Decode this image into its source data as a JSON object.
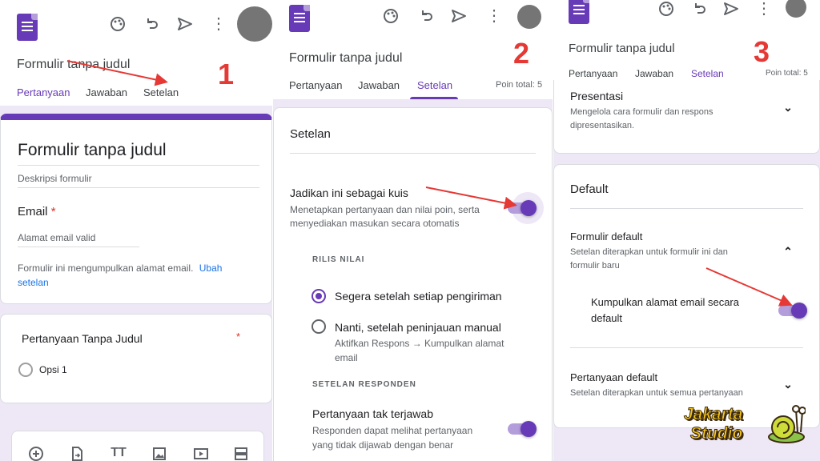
{
  "colors": {
    "accent": "#673ab7",
    "annotation": "#e53935",
    "background": "#ede7f6"
  },
  "panel1": {
    "form_title": "Formulir tanpa judul",
    "tabs": [
      "Pertanyaan",
      "Jawaban",
      "Setelan"
    ],
    "step": "1",
    "card_title": "Formulir tanpa judul",
    "description_placeholder": "Deskripsi formulir",
    "email_label": "Email",
    "required_mark": "*",
    "email_placeholder": "Alamat email valid",
    "collect_notice": "Formulir ini mengumpulkan alamat email.",
    "collect_notice_link_1": "Ubah",
    "collect_notice_link_2": "setelan",
    "question_title": "Pertanyaan Tanpa Judul",
    "question_required": "*",
    "option_1": "Opsi 1",
    "toolbar_icons": [
      "add-question-icon",
      "import-questions-icon",
      "add-title-icon",
      "add-image-icon",
      "add-video-icon",
      "add-section-icon"
    ]
  },
  "panel2": {
    "form_title": "Formulir tanpa judul",
    "tabs": [
      "Pertanyaan",
      "Jawaban",
      "Setelan"
    ],
    "points_total": "Poin total: 5",
    "step": "2",
    "section_title": "Setelan",
    "quiz_title": "Jadikan ini sebagai kuis",
    "quiz_desc_1": "Menetapkan pertanyaan dan nilai poin, serta",
    "quiz_desc_2": "menyediakan masukan secara otomatis",
    "release_heading": "RILIS NILAI",
    "release_option_1": "Segera setelah setiap pengiriman",
    "release_option_2": "Nanti, setelah peninjauan manual",
    "release_option_2_desc_1": "Aktifkan Respons → Kumpulkan alamat",
    "release_option_2_desc_2": "email",
    "respondent_heading": "SETELAN RESPONDEN",
    "unanswered_title": "Pertanyaan tak terjawab",
    "unanswered_desc_1": "Responden dapat melihat pertanyaan",
    "unanswered_desc_2": "yang tidak dijawab dengan benar"
  },
  "panel3": {
    "form_title": "Formulir tanpa judul",
    "tabs": [
      "Pertanyaan",
      "Jawaban",
      "Setelan"
    ],
    "points_total": "Poin total: 5",
    "step": "3",
    "presentation_title": "Presentasi",
    "presentation_desc_1": "Mengelola cara formulir dan respons",
    "presentation_desc_2": "dipresentasikan.",
    "default_title": "Default",
    "form_default_title": "Formulir default",
    "form_default_desc_1": "Setelan diterapkan untuk formulir ini dan",
    "form_default_desc_2": "formulir baru",
    "collect_email_1": "Kumpulkan alamat email secara",
    "collect_email_2": "default",
    "question_default_title": "Pertanyaan default",
    "question_default_desc": "Setelan diterapkan untuk semua pertanyaan"
  },
  "watermark": {
    "line1": "Jakarta",
    "line2": "Studio"
  }
}
